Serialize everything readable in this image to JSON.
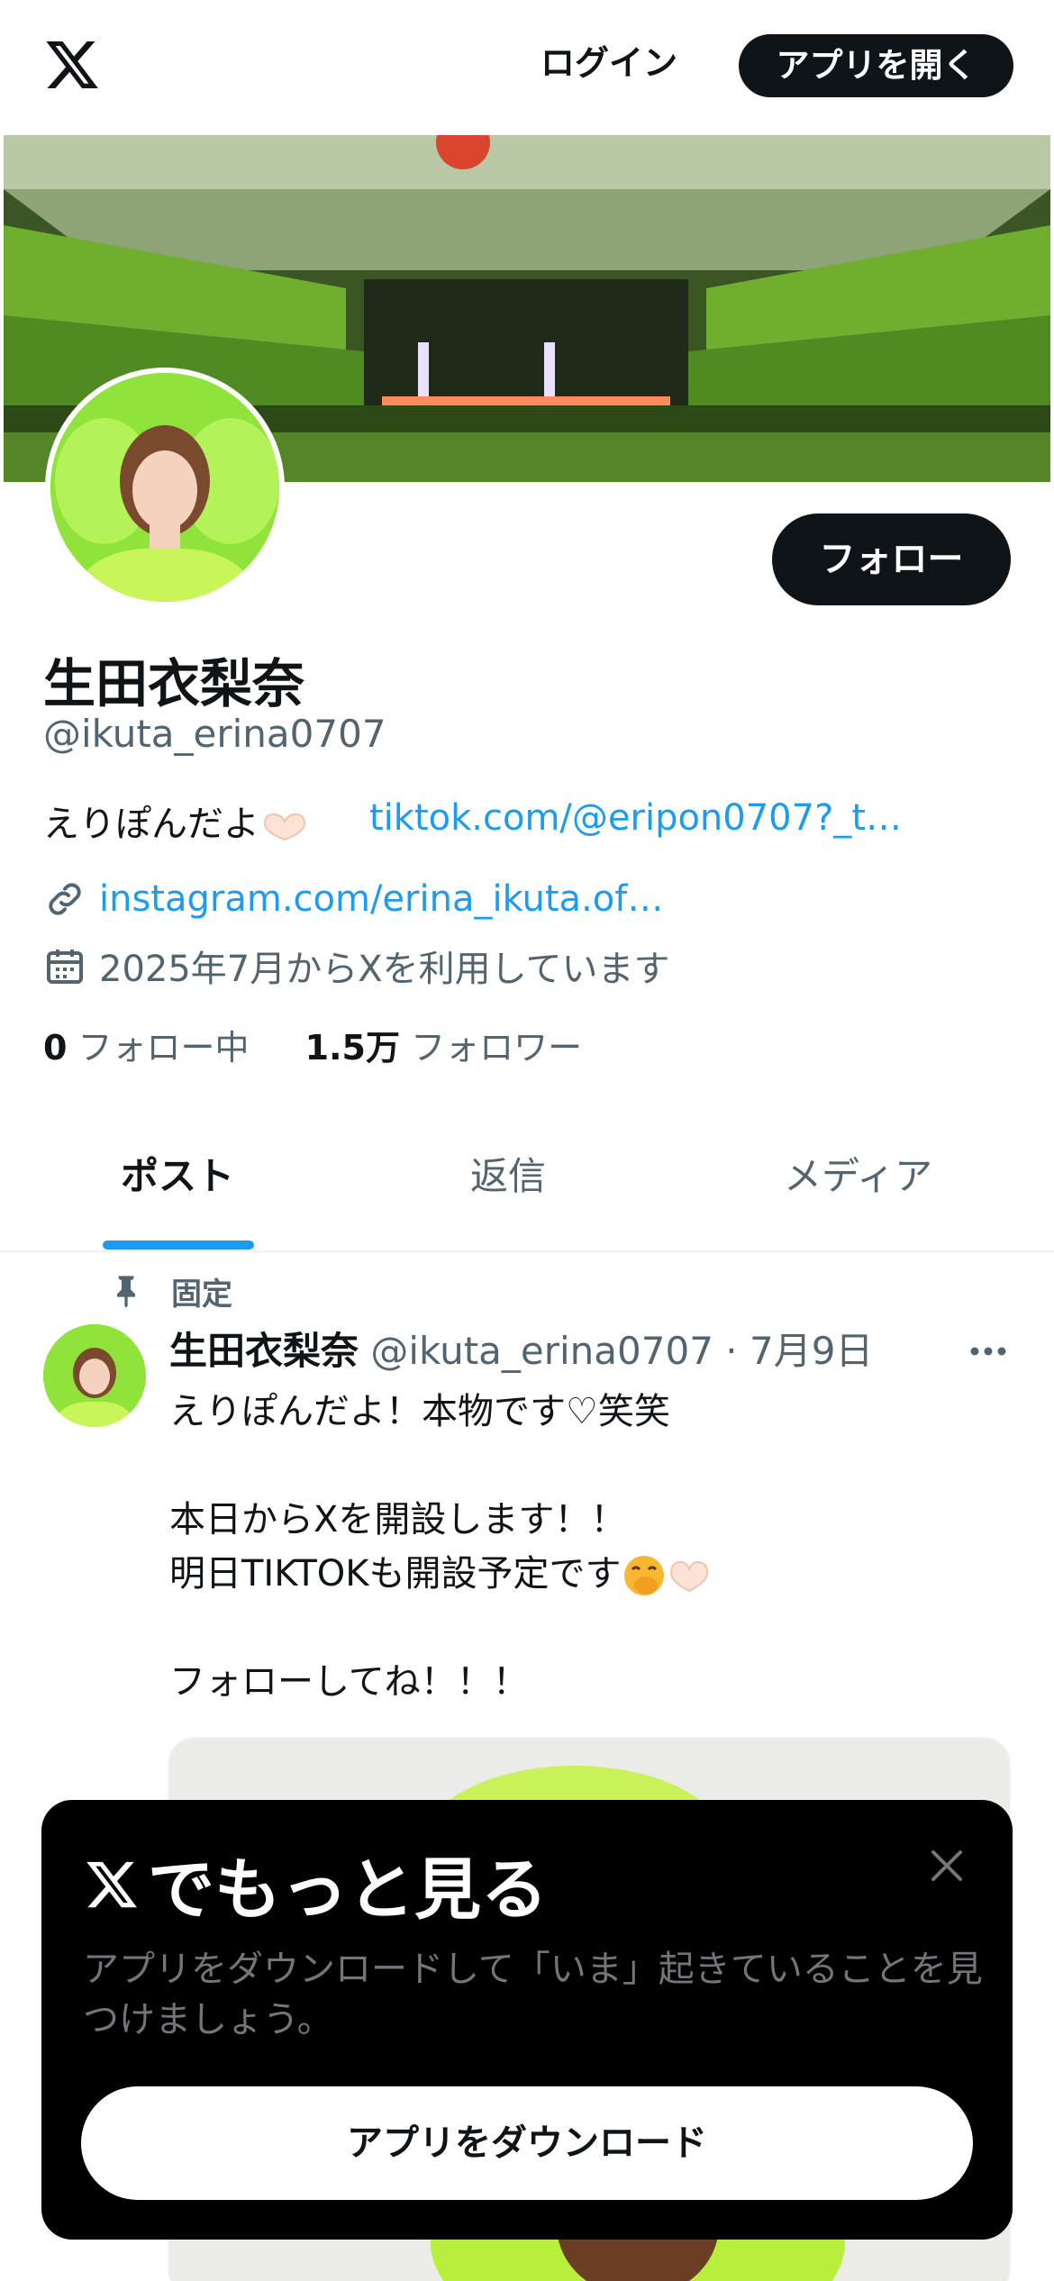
{
  "topbar": {
    "logo": "x-logo",
    "login_label": "ログイン",
    "open_app_label": "アプリを開く"
  },
  "profile": {
    "name": "生田衣梨奈",
    "handle": "@ikuta_erina0707",
    "follow_label": "フォロー",
    "bio_text": "えりぽんだよ",
    "bio_emoji": "heart-hands-emoji",
    "bio_link": "tiktok.com/@eripon0707?_t…",
    "website": "instagram.com/erina_ikuta.of…",
    "joined": "2025年7月からXを利用しています",
    "following_count": "0",
    "following_label": "フォロー中",
    "followers_count": "1.5万",
    "followers_label": "フォロワー"
  },
  "tabs": [
    {
      "label": "ポスト",
      "active": true
    },
    {
      "label": "返信",
      "active": false
    },
    {
      "label": "メディア",
      "active": false
    }
  ],
  "post": {
    "pinned_label": "固定",
    "author_name": "生田衣梨奈",
    "author_meta": "@ikuta_erina0707 · 7月9日",
    "lines": [
      "えりぽんだよ！本物です♡笑笑",
      "本日からXを開設します！！",
      "明日TIKTOKも開設予定です",
      "フォローしてね！！！"
    ],
    "emojis": [
      "face-with-hand-over-mouth-emoji",
      "heart-hands-emoji"
    ]
  },
  "modal": {
    "title": "でもっと見る",
    "description": "アプリをダウンロードして「いま」起きていることを見つけましょう。",
    "button_label": "アプリをダウンロード"
  },
  "colors": {
    "text": "#0f1419",
    "secondary": "#536471",
    "link": "#1d9bf0",
    "dark": "#0f1419",
    "accent_green": "#9bea3a"
  }
}
